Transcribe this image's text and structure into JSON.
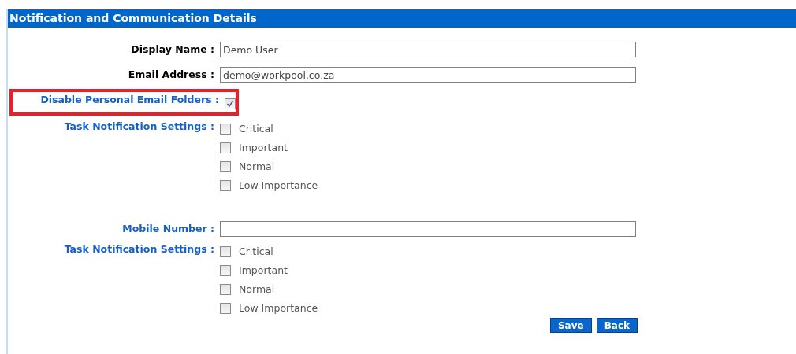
{
  "header": {
    "title": "Notification and Communication Details"
  },
  "rows": [
    {
      "kind": "text",
      "label": "Display Name :",
      "accent": false,
      "value": "Demo User"
    },
    {
      "kind": "text",
      "label": "Email Address :",
      "accent": false,
      "value": "demo@workpool.co.za"
    },
    {
      "kind": "check",
      "label": "Disable Personal Email Folders :",
      "accent": true,
      "highlighted": true,
      "checked": true
    },
    {
      "kind": "options",
      "label": "Task Notification Settings :",
      "accent": true,
      "options": [
        {
          "label": "Critical",
          "checked": false
        },
        {
          "label": "Important",
          "checked": false
        },
        {
          "label": "Normal",
          "checked": false
        },
        {
          "label": "Low Importance",
          "checked": false
        }
      ]
    },
    {
      "kind": "spacer"
    },
    {
      "kind": "text",
      "label": "Mobile Number :",
      "accent": true,
      "value": ""
    },
    {
      "kind": "options",
      "label": "Task Notification Settings :",
      "accent": true,
      "options": [
        {
          "label": "Critical",
          "checked": false
        },
        {
          "label": "Important",
          "checked": false
        },
        {
          "label": "Normal",
          "checked": false
        },
        {
          "label": "Low Importance",
          "checked": false
        }
      ]
    }
  ],
  "buttons": [
    {
      "label": "Save"
    },
    {
      "label": "Back"
    }
  ]
}
